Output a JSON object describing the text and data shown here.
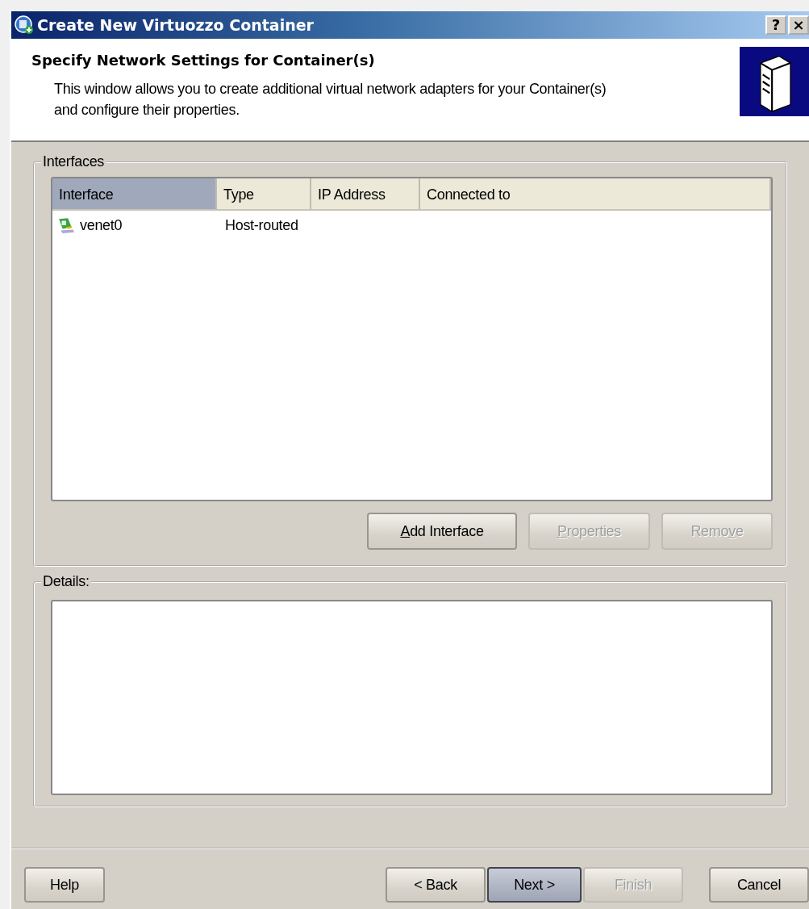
{
  "window": {
    "title": "Create New Virtuozzo Container",
    "title_buttons": [
      "?",
      "×"
    ]
  },
  "header": {
    "title": "Specify Network Settings for Container(s)",
    "description": "This window allows you to create additional virtual network adapters for your Container(s) and configure their properties."
  },
  "interfaces": {
    "label": "Interfaces",
    "columns": [
      {
        "label": "Interface",
        "sorted": true
      },
      {
        "label": "Type",
        "sorted": false
      },
      {
        "label": "IP Address",
        "sorted": false
      },
      {
        "label": "Connected to",
        "sorted": false
      }
    ],
    "rows": [
      {
        "name": "venet0",
        "type": "Host-routed"
      }
    ],
    "buttons": [
      {
        "label": [
          {
            "text": "A",
            "underlined": true
          },
          {
            "text": "dd Interface",
            "underlined": false
          }
        ],
        "disabled": false
      },
      {
        "label": [
          {
            "text": "P",
            "underlined": true
          },
          {
            "text": "roperties",
            "underlined": false
          }
        ],
        "disabled": true
      },
      {
        "label": [
          {
            "text": "Remo",
            "underlined": false
          },
          {
            "text": "v",
            "underlined": true
          },
          {
            "text": "e",
            "underlined": false
          }
        ],
        "disabled": true
      }
    ]
  },
  "details": {
    "label": "Details:"
  },
  "footer": {
    "help": {
      "label": "Help",
      "disabled": false,
      "default": false
    },
    "nav": [
      {
        "label": "< Back",
        "disabled": false,
        "default": false
      },
      {
        "label": "Next >",
        "disabled": false,
        "default": true
      },
      {
        "label": "Finish",
        "disabled": true,
        "default": false
      }
    ],
    "cancel": {
      "label": "Cancel",
      "disabled": false,
      "default": false
    }
  }
}
